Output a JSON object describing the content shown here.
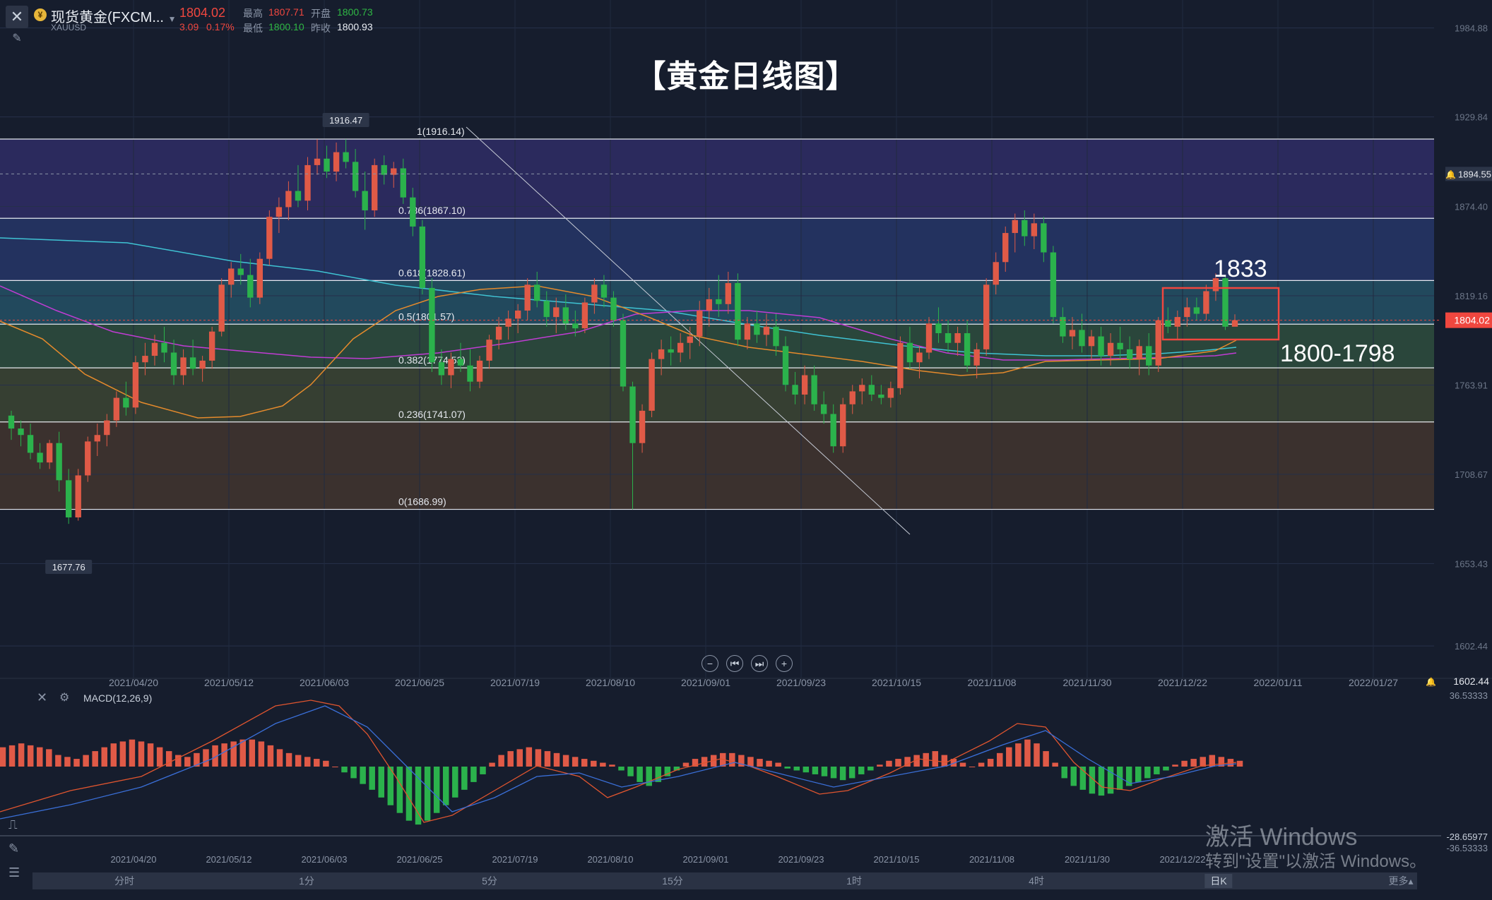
{
  "header": {
    "symbol": "现货黄金(FXCM...",
    "code": "XAUUSD",
    "last": "1804.02",
    "change": "3.09",
    "change_pct": "0.17%",
    "high_label": "最高",
    "high": "1807.71",
    "open_label": "开盘",
    "open": "1800.73",
    "low_label": "最低",
    "low": "1800.10",
    "prev_label": "昨收",
    "prev": "1800.93"
  },
  "title": "【黄金日线图】",
  "annotations": {
    "target_1833": "1833",
    "support": "1800-1798",
    "high_marker": "1916.47",
    "low_marker": "1677.76"
  },
  "nav_icons": [
    "zoom-out-icon",
    "rewind-icon",
    "forward-icon",
    "zoom-in-icon"
  ],
  "chart_data": [
    {
      "type": "candlestick",
      "title": "",
      "price_axis": [
        "1984.88",
        "1929.84",
        "1874.40",
        "1819.16",
        "1763.91",
        "1708.67",
        "1653.43",
        "1602.44"
      ],
      "ylim": [
        1602.44,
        1984.88
      ],
      "current_price_tag": "1804.02",
      "alert_price_tag": "1894.55",
      "dates": [
        "2021/04/20",
        "2021/05/12",
        "2021/06/03",
        "2021/06/25",
        "2021/07/19",
        "2021/08/10",
        "2021/09/01",
        "2021/09/23",
        "2021/10/15",
        "2021/11/08",
        "2021/11/30",
        "2021/12/22",
        "2022/01/11",
        "2022/01/27"
      ],
      "fibonacci": [
        {
          "label": "1(1916.14)",
          "value": 1916.14
        },
        {
          "label": "0.786(1867.10)",
          "value": 1867.1
        },
        {
          "label": "0.618(1828.61)",
          "value": 1828.61
        },
        {
          "label": "0.5(1801.57)",
          "value": 1801.57
        },
        {
          "label": "0.382(1774.53)",
          "value": 1774.53
        },
        {
          "label": "0.236(1741.07)",
          "value": 1741.07
        },
        {
          "label": "0(1686.99)",
          "value": 1686.99
        }
      ],
      "colors": {
        "up": "#e05a47",
        "down": "#2bb24c",
        "ma_cyan": "#3fc3d3",
        "ma_purple": "#c13cd4",
        "ma_orange": "#e58a2c"
      },
      "candles": [
        {
          "o": 1745,
          "h": 1748,
          "l": 1730,
          "c": 1737
        },
        {
          "o": 1737,
          "h": 1742,
          "l": 1726,
          "c": 1733
        },
        {
          "o": 1733,
          "h": 1740,
          "l": 1718,
          "c": 1722
        },
        {
          "o": 1722,
          "h": 1728,
          "l": 1712,
          "c": 1716
        },
        {
          "o": 1716,
          "h": 1730,
          "l": 1712,
          "c": 1728
        },
        {
          "o": 1728,
          "h": 1735,
          "l": 1698,
          "c": 1705
        },
        {
          "o": 1705,
          "h": 1712,
          "l": 1678,
          "c": 1682
        },
        {
          "o": 1682,
          "h": 1712,
          "l": 1680,
          "c": 1708
        },
        {
          "o": 1708,
          "h": 1732,
          "l": 1704,
          "c": 1729
        },
        {
          "o": 1729,
          "h": 1740,
          "l": 1720,
          "c": 1733
        },
        {
          "o": 1733,
          "h": 1746,
          "l": 1726,
          "c": 1742
        },
        {
          "o": 1742,
          "h": 1760,
          "l": 1738,
          "c": 1756
        },
        {
          "o": 1756,
          "h": 1766,
          "l": 1745,
          "c": 1750
        },
        {
          "o": 1750,
          "h": 1782,
          "l": 1746,
          "c": 1778
        },
        {
          "o": 1778,
          "h": 1790,
          "l": 1770,
          "c": 1782
        },
        {
          "o": 1782,
          "h": 1795,
          "l": 1776,
          "c": 1790
        },
        {
          "o": 1790,
          "h": 1800,
          "l": 1778,
          "c": 1784
        },
        {
          "o": 1784,
          "h": 1792,
          "l": 1764,
          "c": 1770
        },
        {
          "o": 1770,
          "h": 1786,
          "l": 1764,
          "c": 1781
        },
        {
          "o": 1781,
          "h": 1792,
          "l": 1770,
          "c": 1774
        },
        {
          "o": 1774,
          "h": 1782,
          "l": 1766,
          "c": 1779
        },
        {
          "o": 1779,
          "h": 1800,
          "l": 1774,
          "c": 1797
        },
        {
          "o": 1797,
          "h": 1830,
          "l": 1794,
          "c": 1826
        },
        {
          "o": 1826,
          "h": 1840,
          "l": 1818,
          "c": 1836
        },
        {
          "o": 1836,
          "h": 1845,
          "l": 1826,
          "c": 1832
        },
        {
          "o": 1832,
          "h": 1842,
          "l": 1812,
          "c": 1818
        },
        {
          "o": 1818,
          "h": 1846,
          "l": 1814,
          "c": 1842
        },
        {
          "o": 1842,
          "h": 1872,
          "l": 1838,
          "c": 1868
        },
        {
          "o": 1868,
          "h": 1880,
          "l": 1858,
          "c": 1874
        },
        {
          "o": 1874,
          "h": 1890,
          "l": 1866,
          "c": 1884
        },
        {
          "o": 1884,
          "h": 1900,
          "l": 1874,
          "c": 1878
        },
        {
          "o": 1878,
          "h": 1905,
          "l": 1872,
          "c": 1900
        },
        {
          "o": 1900,
          "h": 1916,
          "l": 1894,
          "c": 1904
        },
        {
          "o": 1904,
          "h": 1912,
          "l": 1892,
          "c": 1896
        },
        {
          "o": 1896,
          "h": 1914,
          "l": 1890,
          "c": 1908
        },
        {
          "o": 1908,
          "h": 1916,
          "l": 1898,
          "c": 1902
        },
        {
          "o": 1902,
          "h": 1910,
          "l": 1880,
          "c": 1884
        },
        {
          "o": 1884,
          "h": 1896,
          "l": 1860,
          "c": 1872
        },
        {
          "o": 1872,
          "h": 1904,
          "l": 1868,
          "c": 1900
        },
        {
          "o": 1900,
          "h": 1906,
          "l": 1888,
          "c": 1894
        },
        {
          "o": 1894,
          "h": 1902,
          "l": 1886,
          "c": 1898
        },
        {
          "o": 1898,
          "h": 1904,
          "l": 1876,
          "c": 1880
        },
        {
          "o": 1880,
          "h": 1886,
          "l": 1856,
          "c": 1862
        },
        {
          "o": 1862,
          "h": 1866,
          "l": 1820,
          "c": 1824
        },
        {
          "o": 1824,
          "h": 1830,
          "l": 1772,
          "c": 1778
        },
        {
          "o": 1778,
          "h": 1786,
          "l": 1764,
          "c": 1770
        },
        {
          "o": 1770,
          "h": 1784,
          "l": 1762,
          "c": 1780
        },
        {
          "o": 1780,
          "h": 1790,
          "l": 1772,
          "c": 1776
        },
        {
          "o": 1776,
          "h": 1786,
          "l": 1760,
          "c": 1766
        },
        {
          "o": 1766,
          "h": 1782,
          "l": 1762,
          "c": 1779
        },
        {
          "o": 1779,
          "h": 1795,
          "l": 1774,
          "c": 1792
        },
        {
          "o": 1792,
          "h": 1806,
          "l": 1786,
          "c": 1800
        },
        {
          "o": 1800,
          "h": 1810,
          "l": 1792,
          "c": 1805
        },
        {
          "o": 1805,
          "h": 1814,
          "l": 1796,
          "c": 1810
        },
        {
          "o": 1810,
          "h": 1830,
          "l": 1804,
          "c": 1826
        },
        {
          "o": 1826,
          "h": 1834,
          "l": 1812,
          "c": 1816
        },
        {
          "o": 1816,
          "h": 1822,
          "l": 1800,
          "c": 1806
        },
        {
          "o": 1806,
          "h": 1818,
          "l": 1796,
          "c": 1812
        },
        {
          "o": 1812,
          "h": 1820,
          "l": 1798,
          "c": 1802
        },
        {
          "o": 1802,
          "h": 1810,
          "l": 1794,
          "c": 1799
        },
        {
          "o": 1799,
          "h": 1818,
          "l": 1796,
          "c": 1815
        },
        {
          "o": 1815,
          "h": 1830,
          "l": 1808,
          "c": 1826
        },
        {
          "o": 1826,
          "h": 1832,
          "l": 1812,
          "c": 1818
        },
        {
          "o": 1818,
          "h": 1822,
          "l": 1800,
          "c": 1804
        },
        {
          "o": 1804,
          "h": 1808,
          "l": 1760,
          "c": 1763
        },
        {
          "o": 1763,
          "h": 1766,
          "l": 1687,
          "c": 1728
        },
        {
          "o": 1728,
          "h": 1752,
          "l": 1722,
          "c": 1748
        },
        {
          "o": 1748,
          "h": 1784,
          "l": 1744,
          "c": 1780
        },
        {
          "o": 1780,
          "h": 1792,
          "l": 1770,
          "c": 1786
        },
        {
          "o": 1786,
          "h": 1794,
          "l": 1776,
          "c": 1784
        },
        {
          "o": 1784,
          "h": 1796,
          "l": 1778,
          "c": 1790
        },
        {
          "o": 1790,
          "h": 1800,
          "l": 1780,
          "c": 1794
        },
        {
          "o": 1794,
          "h": 1816,
          "l": 1788,
          "c": 1810
        },
        {
          "o": 1810,
          "h": 1824,
          "l": 1800,
          "c": 1817
        },
        {
          "o": 1817,
          "h": 1832,
          "l": 1806,
          "c": 1814
        },
        {
          "o": 1814,
          "h": 1834,
          "l": 1808,
          "c": 1827
        },
        {
          "o": 1827,
          "h": 1833,
          "l": 1788,
          "c": 1792
        },
        {
          "o": 1792,
          "h": 1806,
          "l": 1786,
          "c": 1802
        },
        {
          "o": 1802,
          "h": 1810,
          "l": 1790,
          "c": 1795
        },
        {
          "o": 1795,
          "h": 1808,
          "l": 1788,
          "c": 1800
        },
        {
          "o": 1800,
          "h": 1808,
          "l": 1782,
          "c": 1788
        },
        {
          "o": 1788,
          "h": 1794,
          "l": 1760,
          "c": 1764
        },
        {
          "o": 1764,
          "h": 1772,
          "l": 1752,
          "c": 1758
        },
        {
          "o": 1758,
          "h": 1776,
          "l": 1752,
          "c": 1770
        },
        {
          "o": 1770,
          "h": 1776,
          "l": 1748,
          "c": 1752
        },
        {
          "o": 1752,
          "h": 1760,
          "l": 1740,
          "c": 1746
        },
        {
          "o": 1746,
          "h": 1752,
          "l": 1722,
          "c": 1726
        },
        {
          "o": 1726,
          "h": 1756,
          "l": 1722,
          "c": 1752
        },
        {
          "o": 1752,
          "h": 1764,
          "l": 1746,
          "c": 1760
        },
        {
          "o": 1760,
          "h": 1768,
          "l": 1752,
          "c": 1764
        },
        {
          "o": 1764,
          "h": 1770,
          "l": 1754,
          "c": 1758
        },
        {
          "o": 1758,
          "h": 1764,
          "l": 1752,
          "c": 1756
        },
        {
          "o": 1756,
          "h": 1766,
          "l": 1750,
          "c": 1762
        },
        {
          "o": 1762,
          "h": 1794,
          "l": 1758,
          "c": 1790
        },
        {
          "o": 1790,
          "h": 1800,
          "l": 1774,
          "c": 1778
        },
        {
          "o": 1778,
          "h": 1788,
          "l": 1768,
          "c": 1784
        },
        {
          "o": 1784,
          "h": 1806,
          "l": 1780,
          "c": 1802
        },
        {
          "o": 1802,
          "h": 1812,
          "l": 1790,
          "c": 1796
        },
        {
          "o": 1796,
          "h": 1804,
          "l": 1784,
          "c": 1790
        },
        {
          "o": 1790,
          "h": 1800,
          "l": 1782,
          "c": 1796
        },
        {
          "o": 1796,
          "h": 1804,
          "l": 1772,
          "c": 1776
        },
        {
          "o": 1776,
          "h": 1790,
          "l": 1768,
          "c": 1786
        },
        {
          "o": 1786,
          "h": 1830,
          "l": 1782,
          "c": 1826
        },
        {
          "o": 1826,
          "h": 1846,
          "l": 1820,
          "c": 1840
        },
        {
          "o": 1840,
          "h": 1862,
          "l": 1834,
          "c": 1858
        },
        {
          "o": 1858,
          "h": 1870,
          "l": 1846,
          "c": 1866
        },
        {
          "o": 1866,
          "h": 1872,
          "l": 1850,
          "c": 1856
        },
        {
          "o": 1856,
          "h": 1870,
          "l": 1848,
          "c": 1864
        },
        {
          "o": 1864,
          "h": 1868,
          "l": 1840,
          "c": 1846
        },
        {
          "o": 1846,
          "h": 1850,
          "l": 1802,
          "c": 1806
        },
        {
          "o": 1806,
          "h": 1812,
          "l": 1790,
          "c": 1794
        },
        {
          "o": 1794,
          "h": 1806,
          "l": 1786,
          "c": 1798
        },
        {
          "o": 1798,
          "h": 1808,
          "l": 1784,
          "c": 1788
        },
        {
          "o": 1788,
          "h": 1798,
          "l": 1780,
          "c": 1794
        },
        {
          "o": 1794,
          "h": 1800,
          "l": 1776,
          "c": 1782
        },
        {
          "o": 1782,
          "h": 1796,
          "l": 1776,
          "c": 1790
        },
        {
          "o": 1790,
          "h": 1800,
          "l": 1780,
          "c": 1786
        },
        {
          "o": 1786,
          "h": 1794,
          "l": 1774,
          "c": 1780
        },
        {
          "o": 1780,
          "h": 1792,
          "l": 1770,
          "c": 1788
        },
        {
          "o": 1788,
          "h": 1796,
          "l": 1770,
          "c": 1776
        },
        {
          "o": 1776,
          "h": 1806,
          "l": 1772,
          "c": 1804
        },
        {
          "o": 1804,
          "h": 1812,
          "l": 1796,
          "c": 1800
        },
        {
          "o": 1800,
          "h": 1810,
          "l": 1792,
          "c": 1806
        },
        {
          "o": 1806,
          "h": 1818,
          "l": 1800,
          "c": 1812
        },
        {
          "o": 1812,
          "h": 1818,
          "l": 1804,
          "c": 1808
        },
        {
          "o": 1808,
          "h": 1826,
          "l": 1804,
          "c": 1822
        },
        {
          "o": 1822,
          "h": 1833,
          "l": 1816,
          "c": 1830
        },
        {
          "o": 1830,
          "h": 1832,
          "l": 1798,
          "c": 1800
        },
        {
          "o": 1800,
          "h": 1807.71,
          "l": 1800.1,
          "c": 1804.02
        }
      ]
    },
    {
      "type": "bar",
      "title": "MACD(12,26,9)",
      "axis": [
        "36.53333",
        "-28.65977",
        "-36.53333"
      ],
      "ylim": [
        -36.53,
        36.53
      ],
      "histogram": [
        10,
        11,
        12,
        11,
        10,
        9,
        6,
        5,
        4,
        6,
        8,
        10,
        12,
        13,
        14,
        13,
        12,
        10,
        8,
        6,
        5,
        7,
        9,
        11,
        12,
        13,
        14,
        14,
        13,
        11,
        9,
        7,
        6,
        5,
        4,
        3,
        0,
        -3,
        -6,
        -9,
        -12,
        -16,
        -20,
        -24,
        -28,
        -30,
        -28,
        -24,
        -20,
        -16,
        -12,
        -8,
        -4,
        2,
        6,
        8,
        9,
        10,
        9,
        8,
        7,
        6,
        5,
        4,
        3,
        2,
        1,
        -2,
        -5,
        -8,
        -10,
        -8,
        -5,
        -2,
        2,
        4,
        5,
        6,
        7,
        7,
        6,
        5,
        4,
        3,
        2,
        -1,
        -2,
        -3,
        -4,
        -5,
        -6,
        -7,
        -6,
        -4,
        -2,
        1,
        3,
        4,
        5,
        6,
        7,
        8,
        6,
        4,
        2,
        0,
        2,
        4,
        7,
        10,
        12,
        14,
        12,
        8,
        2,
        -6,
        -10,
        -12,
        -14,
        -15,
        -14,
        -12,
        -10,
        -8,
        -6,
        -4,
        -2,
        1,
        3,
        4,
        5,
        6,
        5,
        4,
        3
      ]
    }
  ],
  "time_axis_main": [
    "2021/04/20",
    "2021/05/12",
    "2021/06/03",
    "2021/06/25",
    "2021/07/19",
    "2021/08/10",
    "2021/09/01",
    "2021/09/23",
    "2021/10/15",
    "2021/11/08",
    "2021/11/30",
    "2021/12/22",
    "2022/01/11",
    "2022/01/27"
  ],
  "time_axis_macd": [
    "2021/04/20",
    "2021/05/12",
    "2021/06/03",
    "2021/06/25",
    "2021/07/19",
    "2021/08/10",
    "2021/09/01",
    "2021/09/23",
    "2021/10/15",
    "2021/11/08",
    "2021/11/30",
    "2021/12/22"
  ],
  "timeframes": [
    {
      "label": "分时"
    },
    {
      "label": "1分"
    },
    {
      "label": "5分"
    },
    {
      "label": "15分"
    },
    {
      "label": "1时"
    },
    {
      "label": "4时"
    },
    {
      "label": "日K"
    },
    {
      "label": "更多▴"
    }
  ],
  "watermark": {
    "line1": "激活 Windows",
    "line2": "转到\"设置\"以激活 Windows。"
  }
}
